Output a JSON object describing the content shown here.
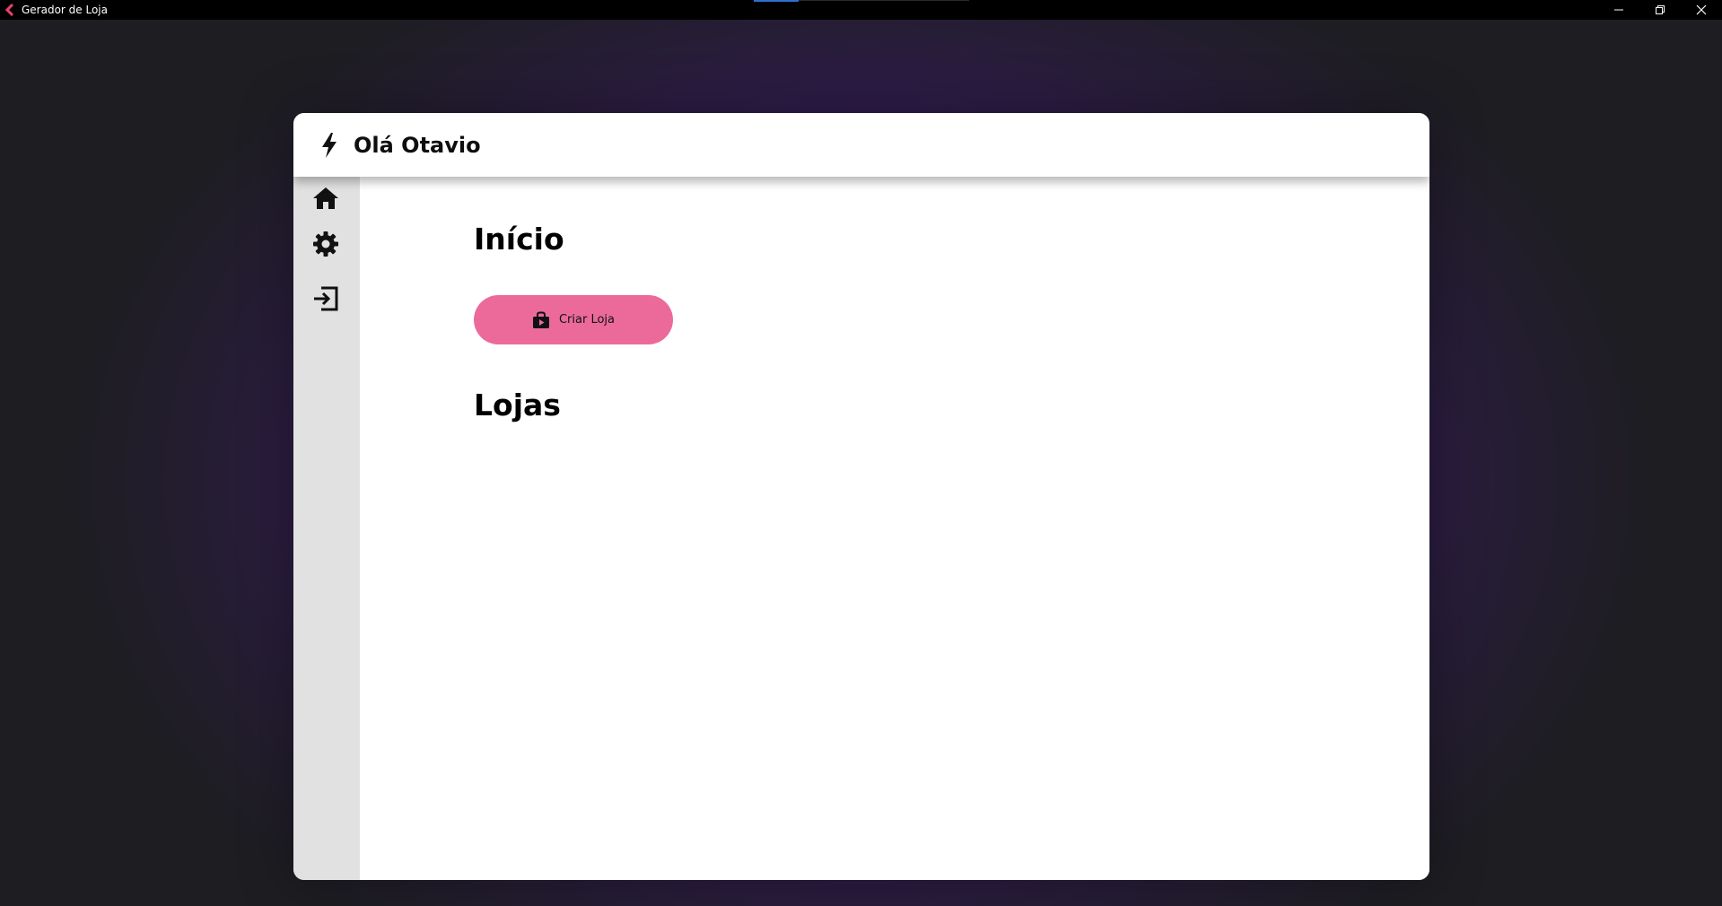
{
  "window": {
    "title": "Gerador de Loja",
    "app_icon": "chevron-left-icon",
    "controls": [
      "minimize-icon",
      "restore-icon",
      "close-icon"
    ]
  },
  "header": {
    "icon": "lightning-bolt-icon",
    "greeting": "Olá Otavio"
  },
  "sidebar": {
    "items": [
      {
        "icon": "home-icon",
        "name": "home"
      },
      {
        "icon": "gear-icon",
        "name": "settings"
      },
      {
        "icon": "logout-icon",
        "name": "logout"
      }
    ]
  },
  "main": {
    "heading": "Início",
    "create_button": {
      "icon": "shopping-bag-icon",
      "label": "Criar Loja"
    },
    "stores_heading": "Lojas"
  },
  "colors": {
    "accent": "#ec6a9a",
    "background": "#1e1d22",
    "glow": "#3a1c63",
    "sidebar": "#e1e1e1"
  }
}
